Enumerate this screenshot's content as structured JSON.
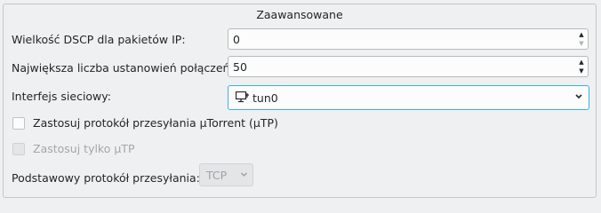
{
  "group": {
    "title": "Zaawansowane"
  },
  "dscp": {
    "label": "Wielkość DSCP dla pakietów IP:",
    "value": "0"
  },
  "max_connections": {
    "label": "Największa liczba ustanowień połączeń:",
    "value": "50"
  },
  "network_interface": {
    "label": "Interfejs sieciowy:",
    "value": "tun0",
    "icon": "network-interface-icon"
  },
  "utp_enable": {
    "label": "Zastosuj protokół przesyłania µTorrent (µTP)",
    "checked": false
  },
  "utp_only": {
    "label": "Zastosuj tylko µTP",
    "checked": false,
    "enabled": false
  },
  "base_protocol": {
    "label": "Podstawowy protokół przesyłania:",
    "value": "TCP",
    "enabled": false
  },
  "colors": {
    "accent": "#3daee9",
    "background": "#eff0f1",
    "text": "#232627"
  }
}
